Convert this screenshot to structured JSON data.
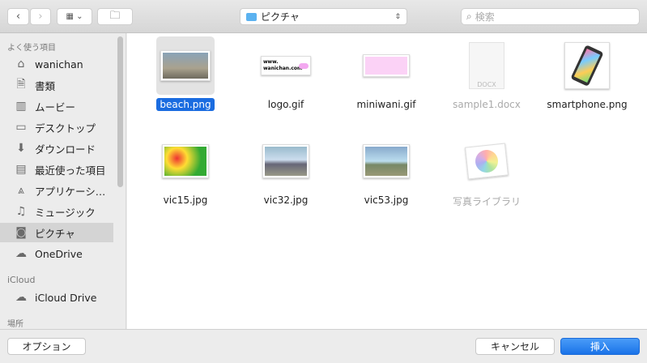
{
  "toolbar": {
    "location": "ピクチャ",
    "search_placeholder": "検索"
  },
  "sidebar": {
    "favorites_header": "よく使う項目",
    "items": [
      {
        "label": "wanichan",
        "icon": "home-icon"
      },
      {
        "label": "書類",
        "icon": "documents-icon"
      },
      {
        "label": "ムービー",
        "icon": "film-icon"
      },
      {
        "label": "デスクトップ",
        "icon": "desktop-icon"
      },
      {
        "label": "ダウンロード",
        "icon": "download-icon"
      },
      {
        "label": "最近使った項目",
        "icon": "recents-icon"
      },
      {
        "label": "アプリケーシ…",
        "icon": "applications-icon"
      },
      {
        "label": "ミュージック",
        "icon": "music-icon"
      },
      {
        "label": "ピクチャ",
        "icon": "camera-icon",
        "selected": true
      },
      {
        "label": "OneDrive",
        "icon": "cloud-icon"
      }
    ],
    "icloud_header": "iCloud",
    "icloud_item": "iCloud Drive",
    "places_header": "場所"
  },
  "files": [
    {
      "name": "beach.png",
      "selected": true
    },
    {
      "name": "logo.gif"
    },
    {
      "name": "miniwani.gif"
    },
    {
      "name": "sample1.docx",
      "disabled": true
    },
    {
      "name": "smartphone.png"
    },
    {
      "name": "vic15.jpg"
    },
    {
      "name": "vic32.jpg"
    },
    {
      "name": "vic53.jpg"
    },
    {
      "name": "写真ライブラリ",
      "disabled": true
    }
  ],
  "logo_text": "www. wanichan.com",
  "buttons": {
    "options": "オプション",
    "cancel": "キャンセル",
    "insert": "挿入"
  },
  "colors": {
    "accent": "#1a6ce0"
  }
}
